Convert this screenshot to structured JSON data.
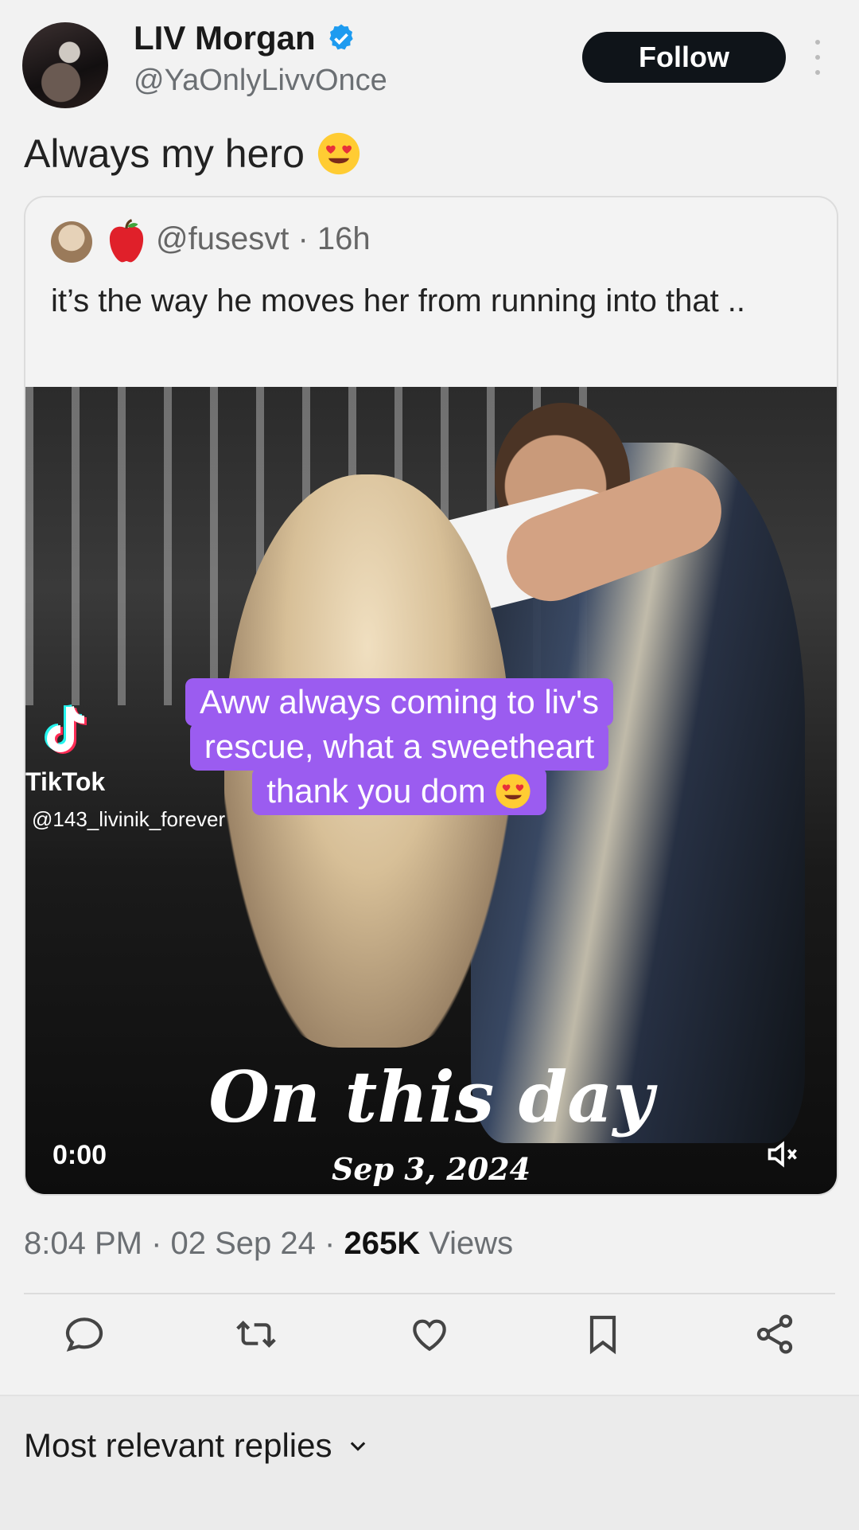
{
  "profile": {
    "name": "LIV Morgan",
    "handle": "@YaOnlyLivvOnce",
    "follow_label": "Follow"
  },
  "tweet": {
    "text": "Always my hero"
  },
  "quote": {
    "handle_time": "@fusesvt · 16h",
    "text": "it’s the way he moves her from running into that .."
  },
  "video": {
    "caption_lines": [
      "Aww always coming to liv's",
      "rescue, what a sweetheart",
      "thank you dom"
    ],
    "tiktok_brand": "TikTok",
    "tiktok_user": "@143_livinik_forever",
    "overlay_title": "On this day",
    "overlay_date": "Sep 3, 2024",
    "timecode": "0:00"
  },
  "meta": {
    "time_date": "8:04 PM · 02 Sep 24 · ",
    "views_count": "265K",
    "views_label": " Views"
  },
  "replies": {
    "label": "Most relevant replies"
  },
  "colors": {
    "follow_bg": "#0f1419",
    "caption_bg": "#9b5cf0",
    "verified": "#1d9bf0"
  }
}
